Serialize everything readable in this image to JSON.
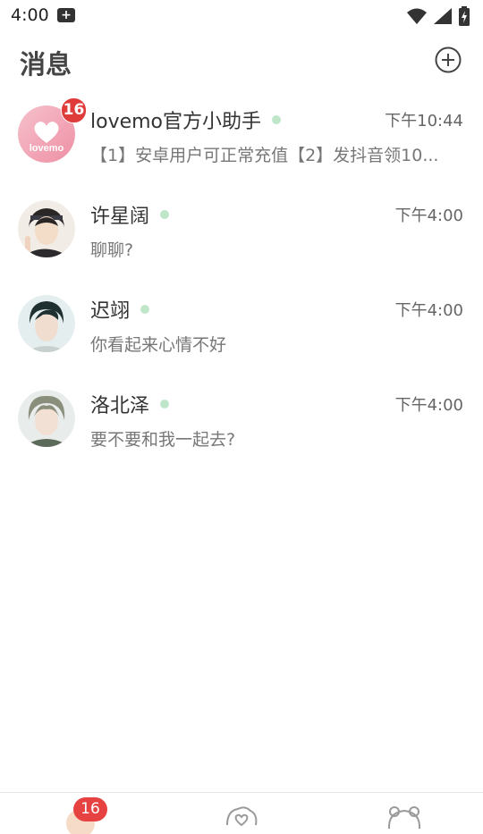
{
  "status_bar": {
    "time": "4:00",
    "notification_icon": "notification-icon",
    "icons": [
      "wifi-icon",
      "signal-icon",
      "battery-icon"
    ]
  },
  "header": {
    "title": "消息",
    "add_icon": "add-circle-icon"
  },
  "conversations": [
    {
      "name": "lovemo官方小助手",
      "time": "下午10:44",
      "preview": "【1】安卓用户可正常充值【2】发抖音领10...",
      "unread": "16",
      "avatar_text": "lovemo",
      "online": true
    },
    {
      "name": "许星阔",
      "time": "下午4:00",
      "preview": "聊聊?",
      "online": true
    },
    {
      "name": "迟翊",
      "time": "下午4:00",
      "preview": "你看起来心情不好",
      "online": true
    },
    {
      "name": "洛北泽",
      "time": "下午4:00",
      "preview": "要不要和我一起去?",
      "online": true
    }
  ],
  "bottom_nav": {
    "messages_badge": "16",
    "items": [
      "messages-tab",
      "discover-tab",
      "profile-tab"
    ]
  },
  "colors": {
    "badge": "#e03b3b",
    "online_dot": "#bfe6c9",
    "brand_pink": "#ef9fb0"
  }
}
